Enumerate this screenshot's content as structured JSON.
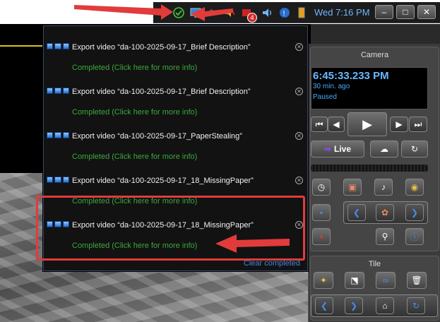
{
  "taskbar": {
    "clock": "Wed 7:16 PM",
    "badge_count": "4",
    "icons": [
      "arrow-icon",
      "check-circle-icon",
      "monitor-icon",
      "speaker-mute-icon",
      "shield-icon",
      "volume-icon",
      "network-icon",
      "battery-icon"
    ]
  },
  "window_controls": {
    "minimize": "–",
    "maximize": "□",
    "close": "✕"
  },
  "notifications": [
    {
      "title": "Export video “da-100-2025-09-17_Brief Description”",
      "status": "Completed (Click here for more info)"
    },
    {
      "title": "Export video “da-100-2025-09-17_Brief Description”",
      "status": "Completed (Click here for more info)"
    },
    {
      "title": "Export video “da-100-2025-09-17_PaperStealing”",
      "status": "Completed (Click here for more info)"
    },
    {
      "title": "Export video “da-100-2025-09-17_18_MissingPaper”",
      "status": "Completed (Click here for more info)"
    },
    {
      "title": "Export video “da-100-2025-09-17_18_MissingPaper”",
      "status": "Completed (Click here for more info)"
    }
  ],
  "clear_completed": "Clear completed",
  "camera_panel": {
    "title": "Camera",
    "time": "6:45:33.233 PM",
    "ago": "30 min. ago",
    "state": "Paused",
    "live_label": "Live"
  },
  "tile_panel": {
    "title": "Tile"
  },
  "colors": {
    "accent": "#3a8ae8",
    "success": "#3ca83c",
    "highlight": "#e23b3b"
  }
}
